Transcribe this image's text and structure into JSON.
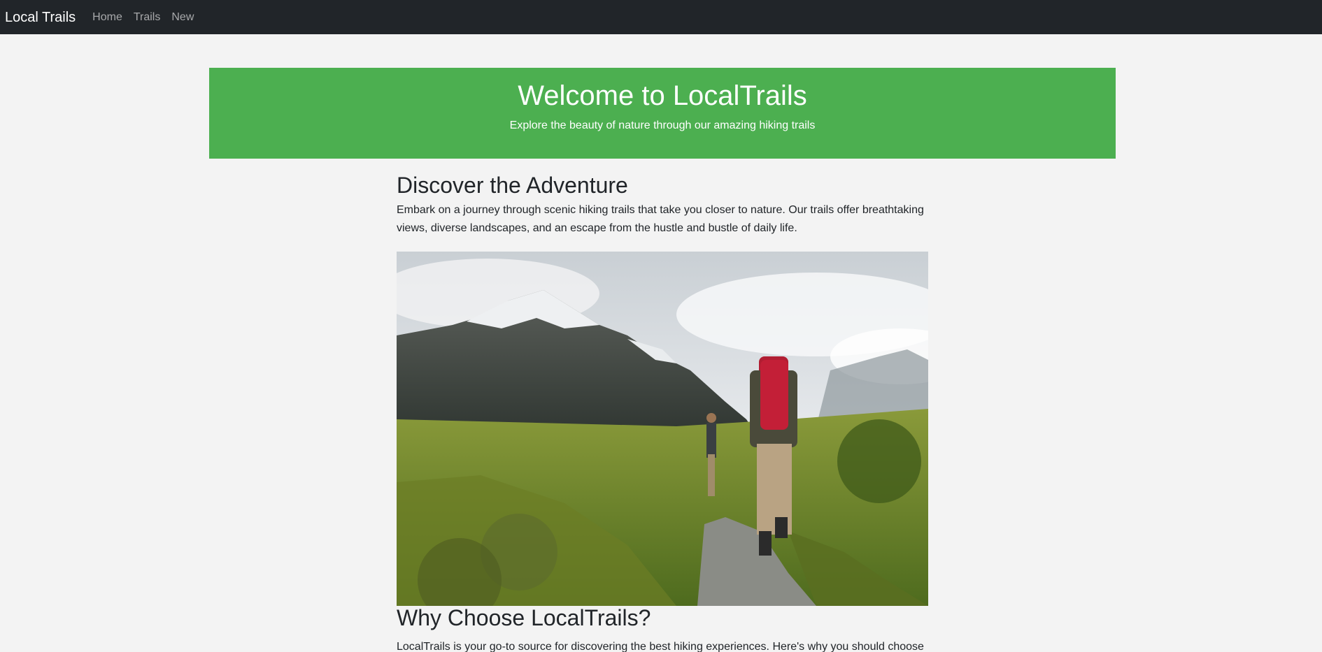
{
  "navbar": {
    "brand": "Local Trails",
    "links": [
      "Home",
      "Trails",
      "New"
    ]
  },
  "hero": {
    "title": "Welcome to LocalTrails",
    "subtitle": "Explore the beauty of nature through our amazing hiking trails",
    "color": "#4caf50"
  },
  "discover": {
    "title": "Discover the Adventure",
    "text": "Embark on a journey through scenic hiking trails that take you closer to nature. Our trails offer breathtaking views, diverse landscapes, and an escape from the hustle and bustle of daily life."
  },
  "why": {
    "title": "Why Choose LocalTrails?",
    "text": "LocalTrails is your go-to source for discovering the best hiking experiences. Here's why you should choose"
  },
  "colors": {
    "navbar_bg": "#212529",
    "page_bg": "#f3f3f3"
  }
}
